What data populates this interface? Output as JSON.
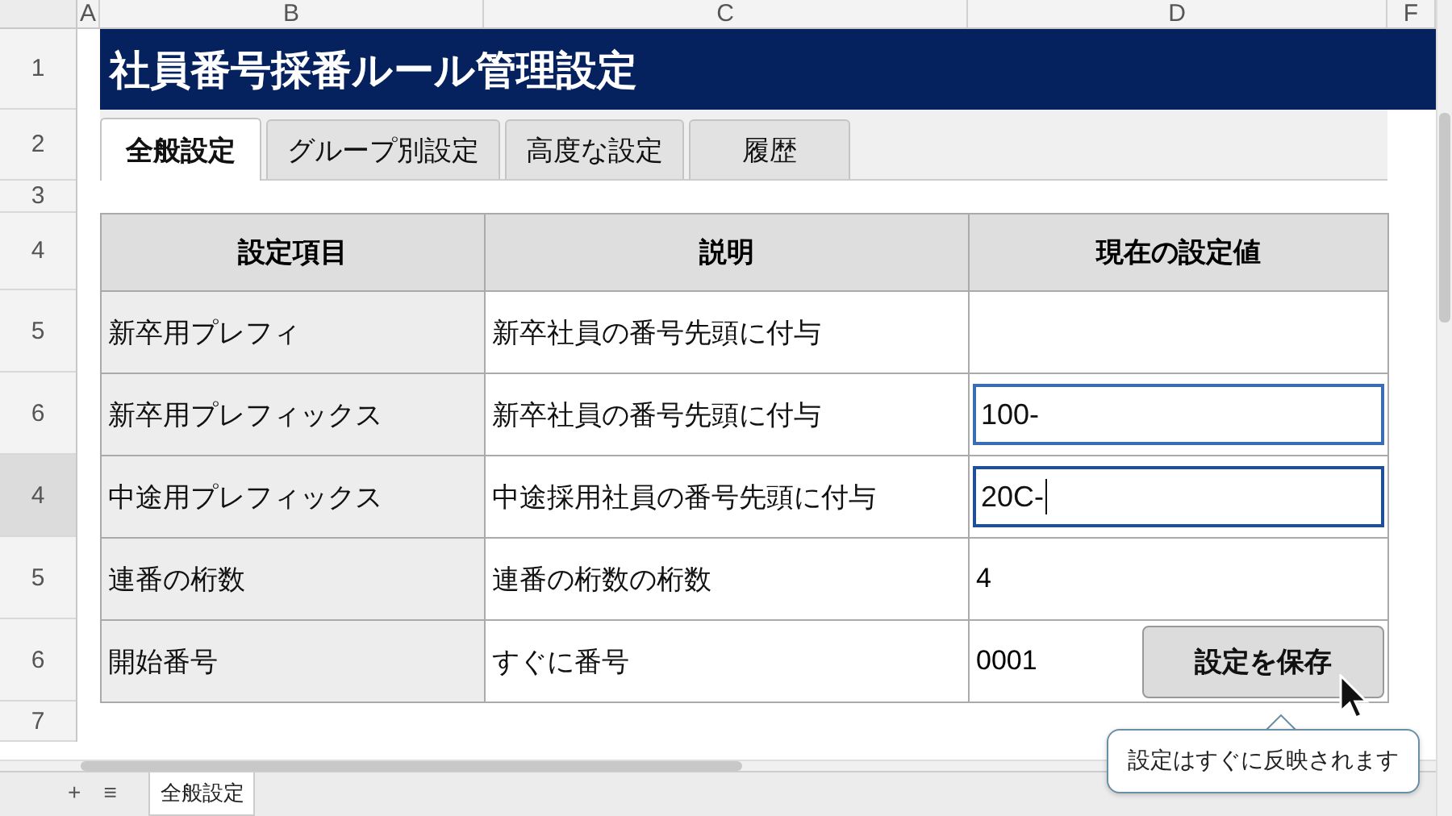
{
  "column_headers": [
    {
      "label": "A"
    },
    {
      "label": "B"
    },
    {
      "label": "C"
    },
    {
      "label": "D"
    },
    {
      "label": "F"
    }
  ],
  "row_headers": [
    {
      "label": "1",
      "selected": false
    },
    {
      "label": "2",
      "selected": false
    },
    {
      "label": "3",
      "selected": false
    },
    {
      "label": "4",
      "selected": false
    },
    {
      "label": "5",
      "selected": false
    },
    {
      "label": "6",
      "selected": false
    },
    {
      "label": "4",
      "selected": true
    },
    {
      "label": "5",
      "selected": false
    },
    {
      "label": "6",
      "selected": false
    },
    {
      "label": "7",
      "selected": false
    }
  ],
  "title": "社員番号採番ルール管理設定",
  "tabs": [
    {
      "label": "全般設定",
      "selected": true
    },
    {
      "label": "グループ別設定",
      "selected": false
    },
    {
      "label": "高度な設定",
      "selected": false
    },
    {
      "label": "履歴",
      "selected": false
    }
  ],
  "table": {
    "columns": [
      "設定項目",
      "説明",
      "現在の設定値"
    ],
    "rows": [
      {
        "item": "新卒用プレフィ",
        "description": "新卒社員の番号先頭に付与",
        "value": {
          "kind": "empty"
        }
      },
      {
        "item": "新卒用プレフィックス",
        "description": "新卒社員の番号先頭に付与",
        "value": {
          "kind": "input",
          "text": "100-",
          "focused": false
        }
      },
      {
        "item": "中途用プレフィックス",
        "description": "中途採用社員の番号先頭に付与",
        "value": {
          "kind": "input",
          "text": "20C-",
          "focused": true
        }
      },
      {
        "item": "連番の桁数",
        "description": "連番の桁数の桁数",
        "value": {
          "kind": "text",
          "text": "4"
        }
      },
      {
        "item": "開始番号",
        "description": "すぐに番号",
        "value": {
          "kind": "text_button",
          "text": "0001",
          "button": "設定を保存"
        }
      }
    ]
  },
  "tooltip": "設定はすぐに反映されます",
  "sheet_bar": {
    "add": "+",
    "menu": "≡",
    "sheets": [
      {
        "label": "全般設定",
        "selected": true
      }
    ]
  }
}
